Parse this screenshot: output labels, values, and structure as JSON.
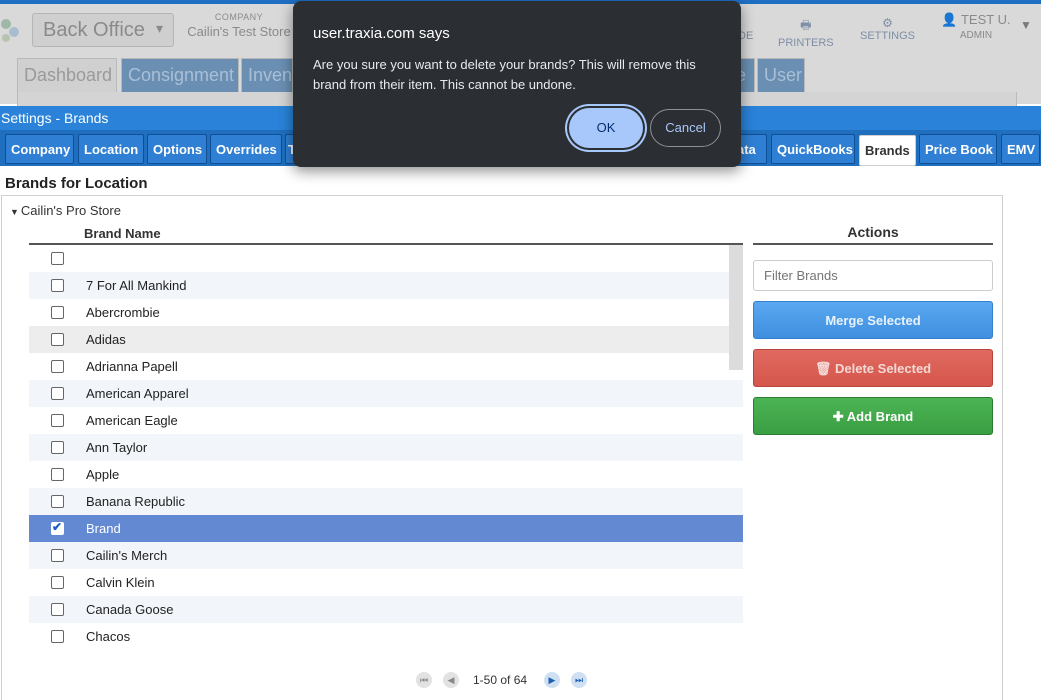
{
  "header": {
    "office_select": "Back Office",
    "company_label": "COMPANY",
    "company_value": "Cailin's Test Store",
    "printers_label": "PRINTERS",
    "settings_label": "SETTINGS",
    "user_name": "TEST U.",
    "user_role": "ADMIN",
    "partial_de": "DE",
    "main_tabs": [
      "Dashboard",
      "Consignment",
      "Inven",
      "e",
      "User"
    ]
  },
  "settings_bar": {
    "title": "Settings - Brands"
  },
  "subnav": {
    "tabs": [
      "Company",
      "Location",
      "Options",
      "Overrides",
      "T",
      "ata",
      "QuickBooks",
      "Brands",
      "Price Book",
      "EMV"
    ]
  },
  "content": {
    "section_title": "Brands for Location",
    "store": "Cailin's Pro Store",
    "column_header": "Brand Name",
    "rows": [
      {
        "name": "",
        "checked": false
      },
      {
        "name": "7 For All Mankind",
        "checked": false
      },
      {
        "name": "Abercrombie",
        "checked": false
      },
      {
        "name": "Adidas",
        "checked": false
      },
      {
        "name": "Adrianna Papell",
        "checked": false
      },
      {
        "name": "American Apparel",
        "checked": false
      },
      {
        "name": "American Eagle",
        "checked": false
      },
      {
        "name": "Ann Taylor",
        "checked": false
      },
      {
        "name": "Apple",
        "checked": false
      },
      {
        "name": "Banana Republic",
        "checked": false
      },
      {
        "name": "Brand",
        "checked": true
      },
      {
        "name": "Cailin's Merch",
        "checked": false
      },
      {
        "name": "Calvin Klein",
        "checked": false
      },
      {
        "name": "Canada Goose",
        "checked": false
      },
      {
        "name": "Chacos",
        "checked": false
      }
    ],
    "pager_text": "1-50 of 64"
  },
  "actions": {
    "header": "Actions",
    "filter_placeholder": "Filter Brands",
    "merge_label": "Merge Selected",
    "delete_label": "Delete Selected",
    "add_label": "Add Brand"
  },
  "dialog": {
    "title": "user.traxia.com says",
    "message": "Are you sure you want to delete your brands?  This will remove this brand from their item.  This cannot be undone.",
    "ok_label": "OK",
    "cancel_label": "Cancel"
  },
  "colors": {
    "accent_blue": "#2a83d8",
    "selected_row": "#6289d2",
    "dialog_bg": "#2b2e33",
    "ok_button": "#a8c7fa",
    "delete_red": "#d5564c",
    "add_green": "#3a9e42"
  }
}
